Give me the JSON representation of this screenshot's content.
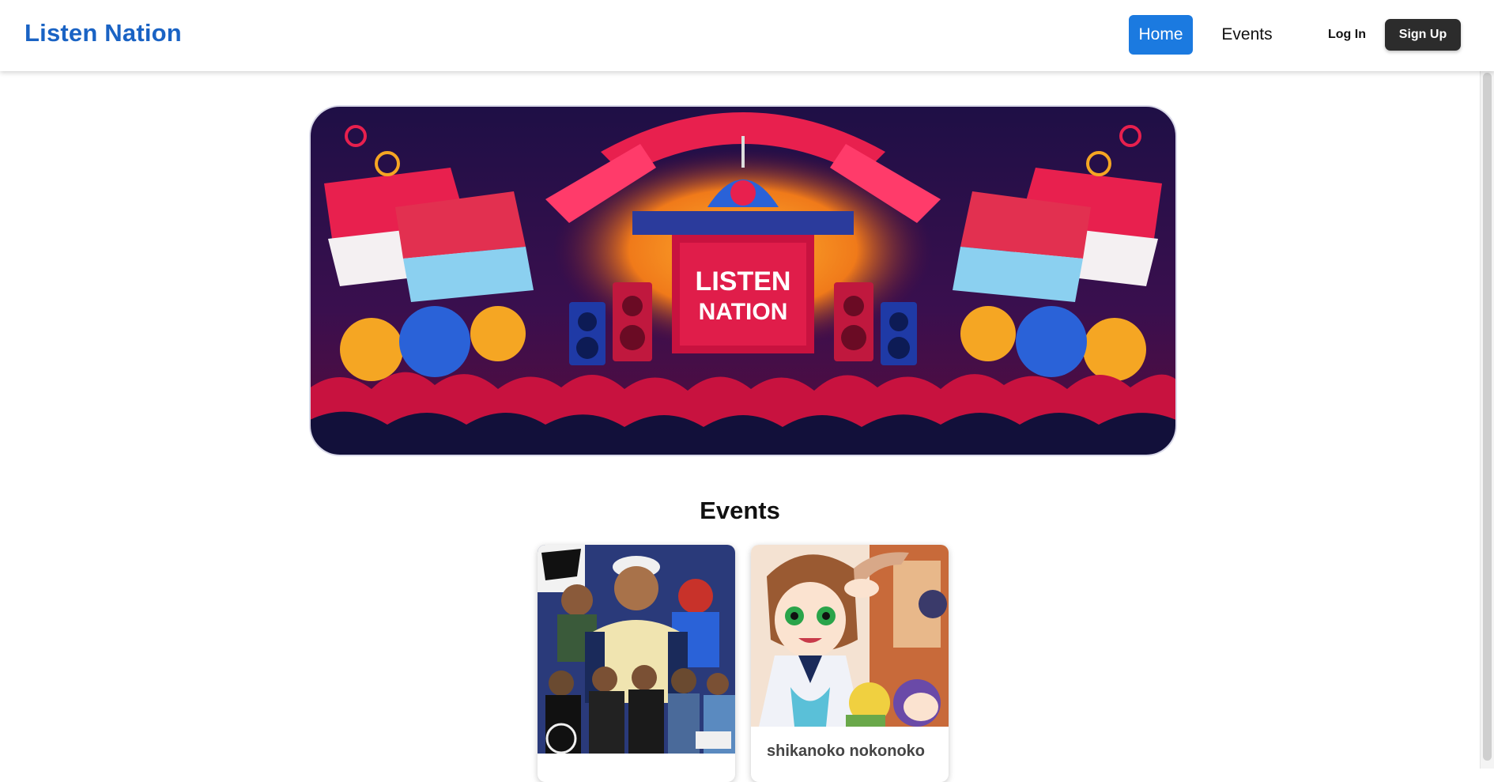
{
  "nav": {
    "brand": "Listen Nation",
    "home_label": "Home",
    "events_label": "Events",
    "login_label": "Log In",
    "signup_label": "Sign Up"
  },
  "hero": {
    "banner_text_line1": "LISTEN",
    "banner_text_line2": "NATION"
  },
  "events_section": {
    "title": "Events",
    "cards": [
      {
        "title": ""
      },
      {
        "title": "shikanoko nokonoko"
      }
    ]
  },
  "colors": {
    "brand": "#1a63c4",
    "accent": "#1b7ae0",
    "signup_bg": "#2c2c2c"
  }
}
